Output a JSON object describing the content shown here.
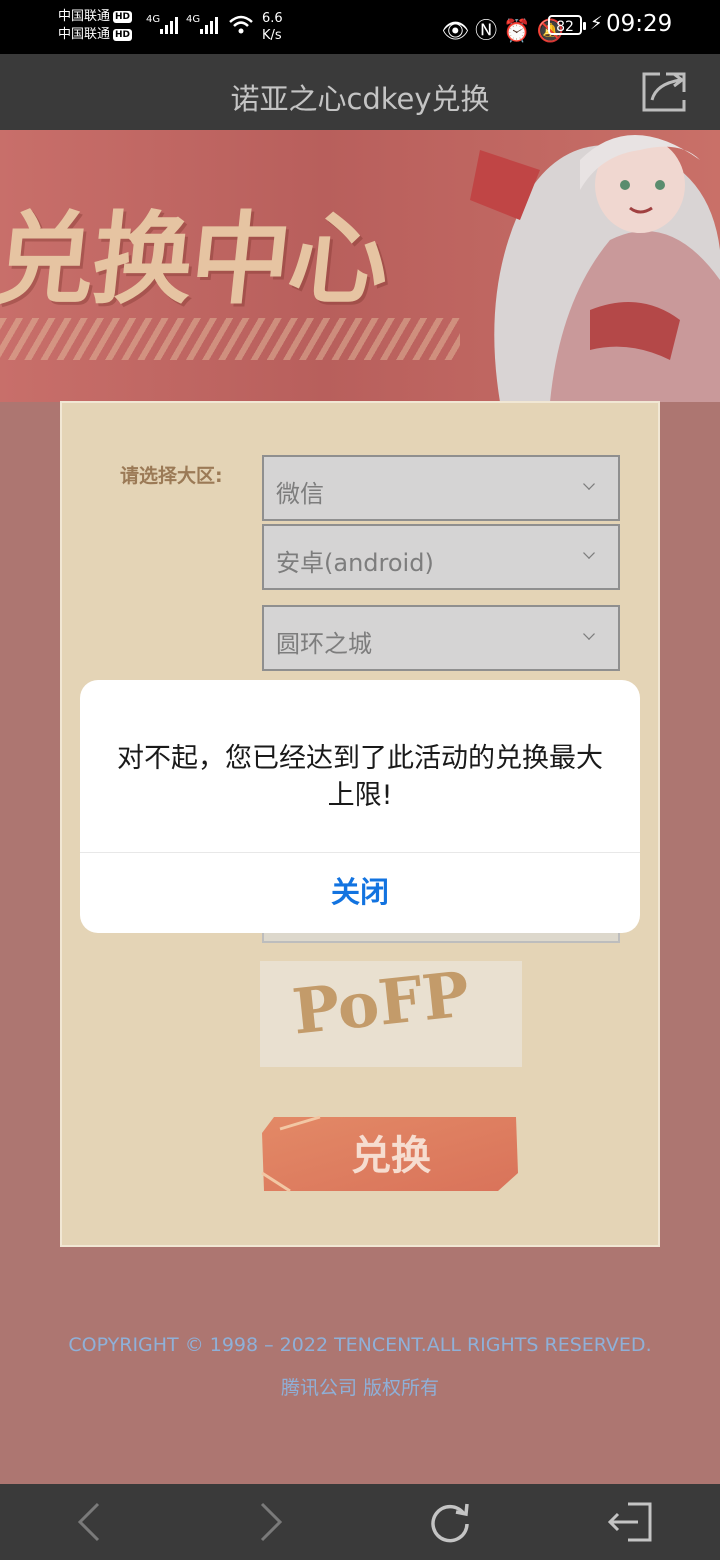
{
  "status_bar": {
    "carrier_1": "中国联通",
    "carrier_2": "中国联通",
    "hd_badge": "HD",
    "network_1": "4G",
    "network_2": "4G",
    "net_speed_value": "6.6",
    "net_speed_unit": "K/s",
    "battery": "82",
    "time": "09:29"
  },
  "title_bar": {
    "title": "诺亚之心cdkey兑换"
  },
  "hero": {
    "heading": "兑换中心"
  },
  "form": {
    "region_label": "请选择大区:",
    "selects": [
      {
        "value": "微信"
      },
      {
        "value": "安卓(android)"
      },
      {
        "value": "圆环之城"
      }
    ],
    "captcha_text": "PoFP",
    "redeem_button": "兑换"
  },
  "footer": {
    "copyright": "COPYRIGHT © 1998 – 2022 TENCENT.ALL RIGHTS RESERVED.",
    "copyright_cn": "腾讯公司 版权所有"
  },
  "dialog": {
    "message": "对不起，您已经达到了此活动的兑换最大上限!",
    "close_button": "关闭"
  },
  "colors": {
    "dialog_button": "#1273e0",
    "panel": "#e4d4b6",
    "overlay_bg": "#ad7671",
    "footer_text": "#8fb0d8"
  },
  "icons": {
    "share": "share-icon",
    "back": "chevron-left-icon",
    "forward": "chevron-right-icon",
    "refresh": "refresh-icon",
    "exit": "exit-icon"
  }
}
